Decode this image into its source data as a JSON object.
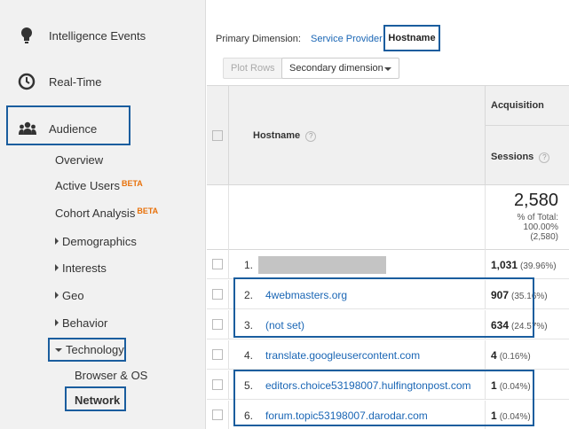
{
  "sidebar": {
    "intelligence": "Intelligence Events",
    "realtime": "Real-Time",
    "audience": "Audience",
    "audience_items": {
      "overview": "Overview",
      "active_users": "Active Users",
      "active_users_badge": "BETA",
      "cohort": "Cohort Analysis",
      "cohort_badge": "BETA",
      "demographics": "Demographics",
      "interests": "Interests",
      "geo": "Geo",
      "behavior": "Behavior",
      "technology": "Technology",
      "browser_os": "Browser & OS",
      "network": "Network"
    },
    "icons": [
      "lightbulb-icon",
      "clock-icon",
      "people-icon"
    ]
  },
  "dimension": {
    "label": "Primary Dimension:",
    "option_service_provider": "Service Provider",
    "option_hostname": "Hostname"
  },
  "toolbar": {
    "plot_rows": "Plot Rows",
    "secondary_dimension": "Secondary dimension"
  },
  "table": {
    "col_hostname": "Hostname",
    "group_acquisition": "Acquisition",
    "col_sessions": "Sessions",
    "help": "?",
    "totals": {
      "sessions": "2,580",
      "pct_of_total_label": "% of Total:",
      "pct_of_total": "100.00%",
      "total_paren": "(2,580)"
    },
    "rows": [
      {
        "idx": "1.",
        "host": "",
        "redacted": true,
        "sessions": "1,031",
        "pct": "(39.96%)"
      },
      {
        "idx": "2.",
        "host": "4webmasters.org",
        "sessions": "907",
        "pct": "(35.16%)"
      },
      {
        "idx": "3.",
        "host": "(not set)",
        "sessions": "634",
        "pct": "(24.57%)"
      },
      {
        "idx": "4.",
        "host": "translate.googleusercontent.com",
        "sessions": "4",
        "pct": "(0.16%)"
      },
      {
        "idx": "5.",
        "host": "editors.choice53198007.hulfingtonpost.com",
        "sessions": "1",
        "pct": "(0.04%)"
      },
      {
        "idx": "6.",
        "host": "forum.topic53198007.darodar.com",
        "sessions": "1",
        "pct": "(0.04%)"
      }
    ]
  },
  "colors": {
    "link": "#1a66b5",
    "highlight_box": "#1a5d9e",
    "beta": "#e8710a"
  }
}
